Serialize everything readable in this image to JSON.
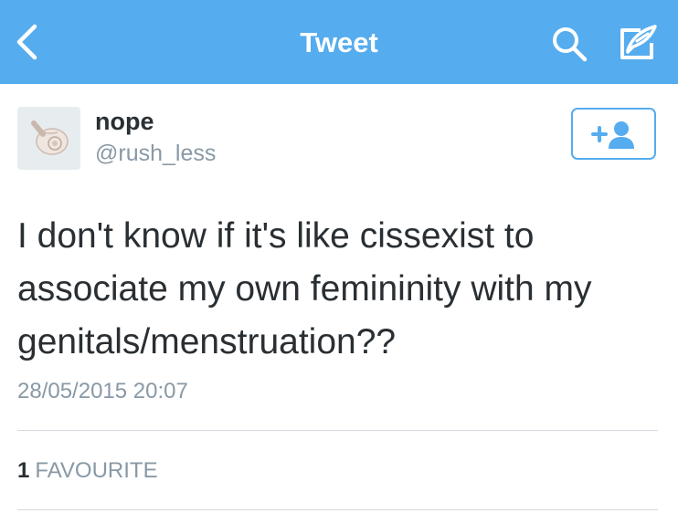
{
  "nav": {
    "title": "Tweet",
    "back_icon": "chevron-left-icon",
    "search_icon": "search-icon",
    "compose_icon": "compose-tweet-icon",
    "background": "#55acee"
  },
  "tweet": {
    "author": {
      "display_name": "nope",
      "handle": "@rush_less",
      "avatar_icon": "seashell-avatar"
    },
    "follow_button_icon": "follow-add-user-icon",
    "text": "I don't know if it's like cissexist to associate my own femininity with my genitals/menstruation??",
    "timestamp": "28/05/2015 20:07",
    "stats": {
      "favourites_count": "1",
      "favourites_label": "FAVOURITE"
    }
  },
  "colors": {
    "accent": "#55acee",
    "text": "#292f33",
    "muted": "#8899a6",
    "divider": "#d4dadf"
  }
}
